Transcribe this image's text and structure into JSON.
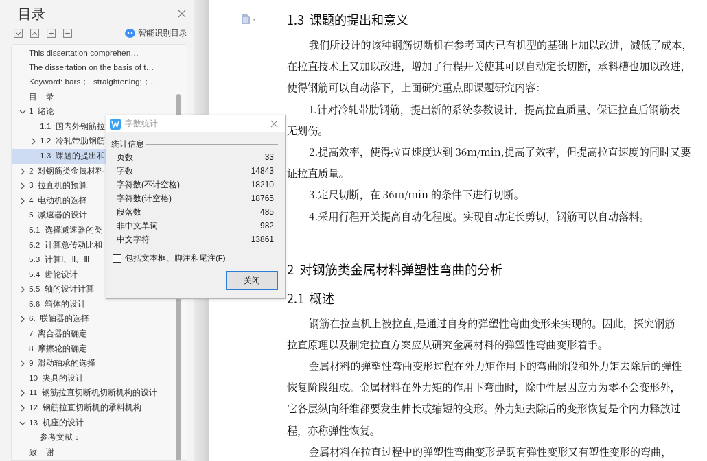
{
  "sidebar": {
    "title": "目录",
    "smart_toc_label": "智能识别目录",
    "tree": [
      {
        "label": "This dissertation comprehen…",
        "kind": "leaf",
        "selected": false
      },
      {
        "label": "The dissertation on the basis of t…",
        "kind": "leaf",
        "selected": false
      },
      {
        "label": "Keyword: bars；  straightening;；…",
        "kind": "leaf",
        "selected": false
      },
      {
        "label": "目    录",
        "kind": "leaf",
        "selected": false
      },
      {
        "label": "1  绪论",
        "kind": "branch",
        "expanded": true,
        "selected": false,
        "children": [
          {
            "label": "1.1  国内外钢筋拉",
            "kind": "leaf",
            "selected": false
          },
          {
            "label": "1.2  冷轧带肋钢筋",
            "kind": "branch",
            "expanded": false,
            "selected": false
          },
          {
            "label": "1.3  课题的提出和",
            "kind": "leaf",
            "selected": true
          }
        ]
      },
      {
        "label": "2  对钢筋类金属材料",
        "kind": "branch",
        "expanded": false,
        "selected": false
      },
      {
        "label": "3  拉直机的预算",
        "kind": "branch",
        "expanded": false,
        "selected": false
      },
      {
        "label": "4  电动机的选择",
        "kind": "branch",
        "expanded": false,
        "selected": false
      },
      {
        "label": "5  减速器的设计",
        "kind": "leaf",
        "selected": false
      },
      {
        "label": "5.1  选择减速器的类",
        "kind": "leaf",
        "selected": false
      },
      {
        "label": "5.2  计算总传动比和",
        "kind": "leaf",
        "selected": false
      },
      {
        "label": "5.3  计算Ⅰ、Ⅱ、Ⅲ",
        "kind": "leaf",
        "selected": false
      },
      {
        "label": "5.4  齿轮设计",
        "kind": "leaf",
        "selected": false
      },
      {
        "label": "5.5  轴的设计计算",
        "kind": "branch",
        "expanded": false,
        "selected": false
      },
      {
        "label": "5.6  箱体的设计",
        "kind": "leaf",
        "selected": false
      },
      {
        "label": "6.  联轴器的选择",
        "kind": "branch",
        "expanded": false,
        "selected": false
      },
      {
        "label": "7  离合器的确定",
        "kind": "leaf",
        "selected": false
      },
      {
        "label": "8  摩擦轮的确定",
        "kind": "leaf",
        "selected": false
      },
      {
        "label": "9  滑动轴承的选择",
        "kind": "branch",
        "expanded": false,
        "selected": false
      },
      {
        "label": "10  夹具的设计",
        "kind": "leaf",
        "selected": false
      },
      {
        "label": "11  钢筋拉直切断机切断机构的设计",
        "kind": "branch",
        "expanded": false,
        "selected": false
      },
      {
        "label": "12  钢筋拉直切断机的承料机构",
        "kind": "branch",
        "expanded": false,
        "selected": false
      },
      {
        "label": "13  机座的设计",
        "kind": "branch",
        "expanded": true,
        "selected": false,
        "children": [
          {
            "label": "参考文献：",
            "kind": "leaf",
            "selected": false
          }
        ]
      },
      {
        "label": "致    谢",
        "kind": "leaf",
        "selected": false
      }
    ]
  },
  "document": {
    "blocks": [
      {
        "kind": "heading",
        "text": "1.3  课题的提出和意义"
      },
      {
        "kind": "first_line",
        "text": "我们所设计的该种钢筋切断机在参考国内已有机型的基础上加以改进，减低了成本，"
      },
      {
        "kind": "line",
        "text": "在拉直技术上又加以改进，增加了行程开关使其可以自动定长切断，承料槽也加以改进，"
      },
      {
        "kind": "line",
        "text": "使得钢筋可以自动落下，上面研究重点即课题研究内容："
      },
      {
        "kind": "first_line",
        "text": "1.针对冷轧带肋钢筋，提出新的系统参数设计，提高拉直质量、保证拉直后钢筋表"
      },
      {
        "kind": "line",
        "text": "无划伤。"
      },
      {
        "kind": "first_line",
        "text": "2.提高效率，使得拉直速度达到 36m/min,提高了效率，但提高拉直速度的同时又要"
      },
      {
        "kind": "line",
        "text": "证拉直质量。"
      },
      {
        "kind": "first_line",
        "text": "3.定尺切断，在 36m/min 的条件下进行切断。"
      },
      {
        "kind": "first_line",
        "text": "4.采用行程开关提高自动化程度。实现自动定长剪切，钢筋可以自动落料。"
      },
      {
        "kind": "chapter",
        "text": "2  对钢筋类金属材料弹塑性弯曲的分析"
      },
      {
        "kind": "heading",
        "text": "2.1  概述"
      },
      {
        "kind": "first_line",
        "text": "钢筋在拉直机上被拉直,是通过自身的弹塑性弯曲变形来实现的。因此，探究钢筋"
      },
      {
        "kind": "line",
        "text": "拉直原理以及制定拉直方案应从研究金属材料的弹塑性弯曲变形着手。"
      },
      {
        "kind": "first_line",
        "text": "金属材料的弹塑性弯曲变形过程在外力矩作用下的弯曲阶段和外力矩去除后的弹性"
      },
      {
        "kind": "line",
        "text": "恢复阶段组成。金属材料在外力矩的作用下弯曲时，除中性层因应力为零不会变形外，"
      },
      {
        "kind": "line",
        "text": "它各层纵向纤维都要发生伸长或缩短的变形。外力矩去除后的变形恢复是个内力释放过"
      },
      {
        "kind": "line",
        "text": "程，亦称弹性恢复。"
      },
      {
        "kind": "first_line",
        "text": "金属材料在拉直过程中的弹塑性弯曲变形是既有弹性变形又有塑性变形的弯曲，"
      }
    ]
  },
  "dialog": {
    "title": "字数统计",
    "group_label": "统计信息",
    "stats": [
      {
        "label": "页数",
        "value": "33"
      },
      {
        "label": "字数",
        "value": "14843"
      },
      {
        "label": "字符数(不计空格)",
        "value": "18210"
      },
      {
        "label": "字符数(计空格)",
        "value": "18765"
      },
      {
        "label": "段落数",
        "value": "485"
      },
      {
        "label": "非中文单词",
        "value": "982"
      },
      {
        "label": "中文字符",
        "value": "13861"
      }
    ],
    "include_option": {
      "label": "包括文本框、脚注和尾注(F)",
      "checked": false
    },
    "close_button": "关闭"
  }
}
